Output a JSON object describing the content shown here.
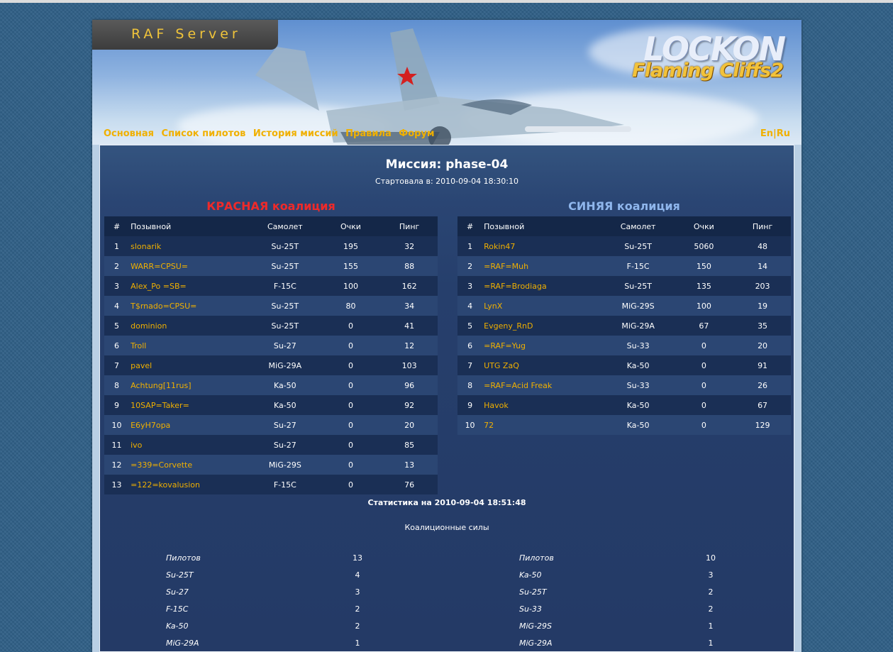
{
  "header": {
    "server_title": "RAF Server",
    "logo_line1": "LOCKON",
    "logo_line2": "Flaming Cliffs2",
    "nav": [
      "Основная",
      "Список пилотов",
      "История миссий",
      "Правила",
      "Форум"
    ],
    "lang_en": "En",
    "lang_sep": "|",
    "lang_ru": "Ru"
  },
  "mission": {
    "title": "Миссия: phase-04",
    "started": "Стартовала в: 2010-09-04 18:30:10"
  },
  "columns": {
    "num": "#",
    "nick": "Позывной",
    "plane": "Самолет",
    "points": "Очки",
    "ping": "Пинг"
  },
  "red": {
    "title": "КРАСНАЯ коалиция",
    "players": [
      {
        "n": "1",
        "nick": "slonarik",
        "plane": "Su-25T",
        "points": "195",
        "ping": "32"
      },
      {
        "n": "2",
        "nick": "WARR=CPSU=",
        "plane": "Su-25T",
        "points": "155",
        "ping": "88"
      },
      {
        "n": "3",
        "nick": "Alex_Po =SB=",
        "plane": "F-15C",
        "points": "100",
        "ping": "162"
      },
      {
        "n": "4",
        "nick": "T$rnado=CPSU=",
        "plane": "Su-25T",
        "points": "80",
        "ping": "34"
      },
      {
        "n": "5",
        "nick": "dominion",
        "plane": "Su-25T",
        "points": "0",
        "ping": "41"
      },
      {
        "n": "6",
        "nick": "Troll",
        "plane": "Su-27",
        "points": "0",
        "ping": "12"
      },
      {
        "n": "7",
        "nick": "pavel",
        "plane": "MiG-29A",
        "points": "0",
        "ping": "103"
      },
      {
        "n": "8",
        "nick": "Achtung[11rus]",
        "plane": "Ka-50",
        "points": "0",
        "ping": "96"
      },
      {
        "n": "9",
        "nick": "10SAP=Taker=",
        "plane": "Ka-50",
        "points": "0",
        "ping": "92"
      },
      {
        "n": "10",
        "nick": "E6yH7opa",
        "plane": "Su-27",
        "points": "0",
        "ping": "20"
      },
      {
        "n": "11",
        "nick": "ivo",
        "plane": "Su-27",
        "points": "0",
        "ping": "85"
      },
      {
        "n": "12",
        "nick": "=339=Corvette",
        "plane": "MiG-29S",
        "points": "0",
        "ping": "13"
      },
      {
        "n": "13",
        "nick": "=122=kovalusion",
        "plane": "F-15C",
        "points": "0",
        "ping": "76"
      }
    ],
    "forces": [
      {
        "label": "Пилотов",
        "value": "13"
      },
      {
        "label": "Su-25T",
        "value": "4"
      },
      {
        "label": "Su-27",
        "value": "3"
      },
      {
        "label": "F-15C",
        "value": "2"
      },
      {
        "label": "Ka-50",
        "value": "2"
      },
      {
        "label": "MiG-29A",
        "value": "1"
      }
    ]
  },
  "blue": {
    "title": "СИНЯЯ коалиция",
    "players": [
      {
        "n": "1",
        "nick": "Rokin47",
        "plane": "Su-25T",
        "points": "5060",
        "ping": "48"
      },
      {
        "n": "2",
        "nick": "=RAF=Muh",
        "plane": "F-15C",
        "points": "150",
        "ping": "14"
      },
      {
        "n": "3",
        "nick": "=RAF=Brodiaga",
        "plane": "Su-25T",
        "points": "135",
        "ping": "203"
      },
      {
        "n": "4",
        "nick": "LynX",
        "plane": "MiG-29S",
        "points": "100",
        "ping": "19"
      },
      {
        "n": "5",
        "nick": "Evgeny_RnD",
        "plane": "MiG-29A",
        "points": "67",
        "ping": "35"
      },
      {
        "n": "6",
        "nick": "=RAF=Yug",
        "plane": "Su-33",
        "points": "0",
        "ping": "20"
      },
      {
        "n": "7",
        "nick": "UTG ZaQ",
        "plane": "Ka-50",
        "points": "0",
        "ping": "91"
      },
      {
        "n": "8",
        "nick": "=RAF=Acid Freak",
        "plane": "Su-33",
        "points": "0",
        "ping": "26"
      },
      {
        "n": "9",
        "nick": "Havok",
        "plane": "Ka-50",
        "points": "0",
        "ping": "67"
      },
      {
        "n": "10",
        "nick": "72",
        "plane": "Ka-50",
        "points": "0",
        "ping": "129"
      }
    ],
    "forces": [
      {
        "label": "Пилотов",
        "value": "10"
      },
      {
        "label": "Ka-50",
        "value": "3"
      },
      {
        "label": "Su-25T",
        "value": "2"
      },
      {
        "label": "Su-33",
        "value": "2"
      },
      {
        "label": "MiG-29S",
        "value": "1"
      },
      {
        "label": "MiG-29A",
        "value": "1"
      }
    ]
  },
  "stats": {
    "title": "Статистика на 2010-09-04 18:51:48",
    "subtitle": "Коалиционные силы"
  },
  "colors": {
    "accent": "#f0b000",
    "red_coalition": "#ee2a2a",
    "blue_coalition": "#8fb6ec",
    "content_bg": "#263f6c"
  }
}
